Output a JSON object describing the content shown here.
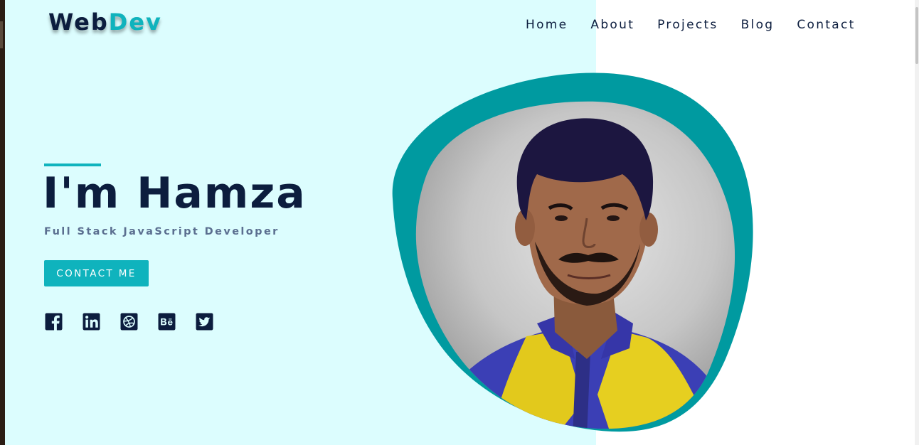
{
  "brand": {
    "part1": "Web",
    "part2": "Dev"
  },
  "nav": {
    "items": [
      "Home",
      "About",
      "Projects",
      "Blog",
      "Contact"
    ]
  },
  "hero": {
    "title": "I'm Hamza",
    "subtitle": "Full Stack JavaScript Developer",
    "cta_label": "CONTACT ME"
  },
  "socials": [
    {
      "icon": "facebook-icon"
    },
    {
      "icon": "linkedin-icon"
    },
    {
      "icon": "dribbble-icon"
    },
    {
      "icon": "behance-icon"
    },
    {
      "icon": "twitter-icon"
    }
  ],
  "colors": {
    "navy": "#0c1d3e",
    "teal": "#0fb3bd",
    "blob": "#009aa0",
    "hero_bg": "#dcfdfe",
    "subtitle": "#5b6f90"
  }
}
